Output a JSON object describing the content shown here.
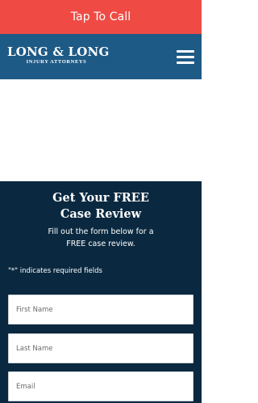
{
  "colors": {
    "call_bar": "#ef4b44",
    "header": "#1e5a86",
    "form_section": "#0a2940"
  },
  "call_bar": {
    "label": "Tap To Call"
  },
  "header": {
    "logo_name": "LONG & LONG",
    "logo_subtitle": "INJURY ATTORNEYS",
    "menu_icon": "hamburger-menu-icon"
  },
  "form": {
    "title_line1": "Get Your FREE",
    "title_line2": "Case Review",
    "intro_line1": "Fill out the form below for a",
    "intro_line2": "FREE case review.",
    "required_note": "\"*\" indicates required fields",
    "fields": {
      "first_name": {
        "placeholder": "First Name",
        "value": ""
      },
      "last_name": {
        "placeholder": "Last Name",
        "value": ""
      },
      "email": {
        "placeholder": "Email",
        "value": ""
      }
    }
  }
}
